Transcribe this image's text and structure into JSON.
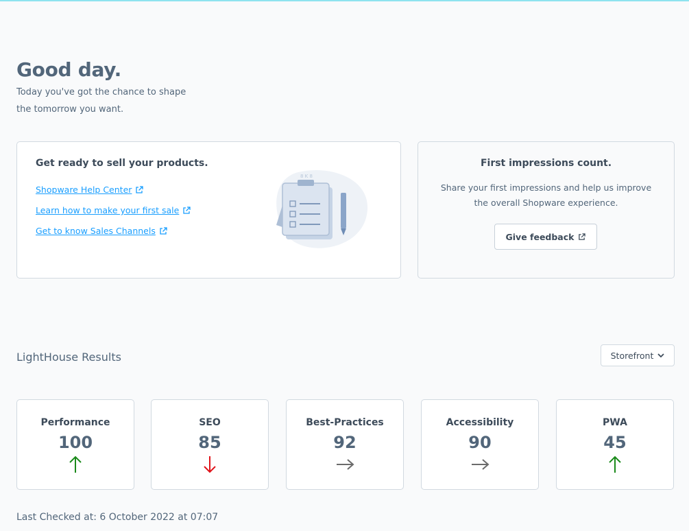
{
  "greeting": {
    "title": "Good day.",
    "subtitle": "Today you've got the chance to shape the tomorrow you want."
  },
  "sell_card": {
    "title": "Get ready to sell your products.",
    "links": [
      {
        "label": "Shopware Help Center"
      },
      {
        "label": "Learn how to make your first sale"
      },
      {
        "label": "Get to know Sales Channels"
      }
    ]
  },
  "feedback_card": {
    "title": "First impressions count.",
    "text": "Share your first impressions and help us improve the overall Shopware experience.",
    "button_label": "Give feedback"
  },
  "lighthouse": {
    "title": "LightHouse Results",
    "select_value": "Storefront",
    "metrics": [
      {
        "label": "Performance",
        "value": "100",
        "trend": "up",
        "color": "#1a8a1a"
      },
      {
        "label": "SEO",
        "value": "85",
        "trend": "down",
        "color": "#e0131a"
      },
      {
        "label": "Best-Practices",
        "value": "92",
        "trend": "flat",
        "color": "#6b6b6b"
      },
      {
        "label": "Accessibility",
        "value": "90",
        "trend": "flat",
        "color": "#6b6b6b"
      },
      {
        "label": "PWA",
        "value": "45",
        "trend": "up",
        "color": "#1a8a1a"
      }
    ],
    "last_checked": "Last Checked at: 6 October 2022 at 07:07"
  }
}
